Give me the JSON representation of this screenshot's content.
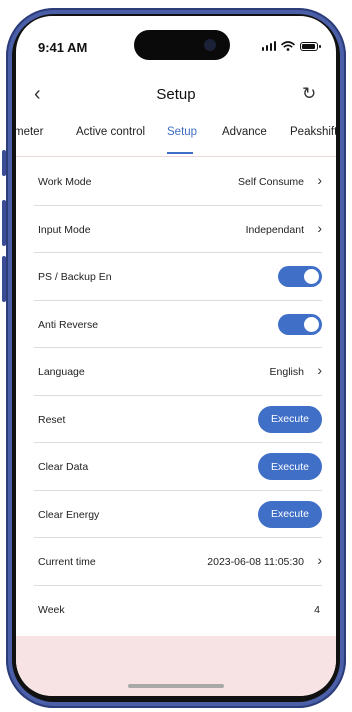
{
  "status_bar": {
    "time": "9:41 AM"
  },
  "nav": {
    "title": "Setup"
  },
  "tabs": [
    {
      "label": "meter",
      "active": false
    },
    {
      "label": "Active control",
      "active": false
    },
    {
      "label": "Setup",
      "active": true
    },
    {
      "label": "Advance",
      "active": false
    },
    {
      "label": "Peakshift",
      "active": false
    }
  ],
  "settings": {
    "work_mode": {
      "label": "Work Mode",
      "value": "Self Consume"
    },
    "input_mode": {
      "label": "Input Mode",
      "value": "Independant"
    },
    "ps_backup": {
      "label": "PS / Backup En",
      "enabled": true
    },
    "anti_reverse": {
      "label": "Anti Reverse",
      "enabled": true
    },
    "language": {
      "label": "Language",
      "value": "English"
    },
    "reset": {
      "label": "Reset",
      "button": "Execute"
    },
    "clear_data": {
      "label": "Clear Data",
      "button": "Execute"
    },
    "clear_energy": {
      "label": "Clear Energy",
      "button": "Execute"
    },
    "current_time": {
      "label": "Current time",
      "value": "2023-06-08 11:05:30"
    },
    "week": {
      "label": "Week",
      "value": "4"
    }
  },
  "colors": {
    "accent": "#3f6fc6",
    "bottom_band": "#f7e3e3",
    "frame": "#4a5fa8"
  }
}
